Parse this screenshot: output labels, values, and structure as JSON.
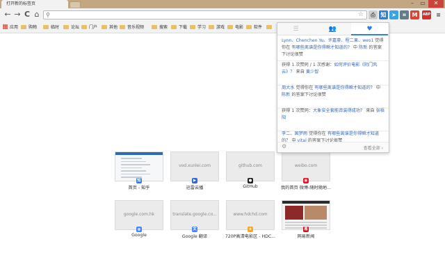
{
  "window": {
    "tab_title": "打开新的标签页",
    "controls": {
      "minimize": "–",
      "maximize": "▭",
      "close": "✕"
    }
  },
  "toolbar": {
    "back": "←",
    "forward": "→",
    "reload": "C",
    "home": "⌂",
    "omnibox_value": "",
    "omnibox_placeholder": "",
    "extensions": [
      {
        "icon": "printer-icon",
        "label": "⎙",
        "color": "#cfcfcf"
      },
      {
        "icon": "zhihu-icon",
        "label": "知",
        "color": "#2d82d6"
      },
      {
        "icon": "paper-plane-icon",
        "label": "➤",
        "color": "#3aa3e3"
      },
      {
        "icon": "crop-icon",
        "label": "⌗",
        "color": "#607d8b"
      },
      {
        "icon": "gmail-icon",
        "label": "M",
        "color": "#d44638"
      },
      {
        "icon": "adblock-icon",
        "label": "ABP",
        "color": "#d32f2f"
      },
      {
        "icon": "menu-icon",
        "label": "≡",
        "color": "#f2f2f2"
      }
    ]
  },
  "bookmarks": {
    "apps_label": "应用",
    "folders": [
      "购物",
      "临时",
      "论坛",
      "门户",
      "其他",
      "音乐视频",
      "搜索",
      "下载",
      "学习",
      "游戏",
      "电影",
      "软件",
      ""
    ]
  },
  "popup": {
    "tabs": [
      {
        "icon": "list-icon",
        "label": "☰"
      },
      {
        "icon": "people-icon",
        "label": "👥"
      },
      {
        "icon": "heart-icon",
        "label": "♥"
      }
    ],
    "items": [
      {
        "users": "Lynn、Chenchen Yu、许嘉豪、程二果、wes1",
        "text": " 觉得你在 ",
        "question": "有哪些离谱是你得瞬才知道的？",
        "tail": " 中 ",
        "author": "陈新",
        "end": " 的答案下讨论很赞"
      },
      {
        "users": "",
        "text": "获得 1 次赞同 / 1 次感谢：",
        "question": "如何评价电影《阴门风云》？",
        "tail": " 来自 ",
        "author": "黄少智",
        "end": ""
      },
      {
        "users": "周大水",
        "text": " 觉得你在 ",
        "question": "有哪些离谱是你得瞬才知道的？",
        "tail": " 中 ",
        "author": "陈新",
        "end": " 的答案下讨论很赞"
      },
      {
        "users": "",
        "text": "获得 1 次赞同：",
        "question": "大象安全套能否装得成功？",
        "tail": " 来自 ",
        "author": "张梧阳",
        "end": ""
      },
      {
        "users": "李二、国梦雨",
        "text": " 觉得你在 ",
        "question": "有哪些离谱是你得瞬才知道的？",
        "tail": " 中 ",
        "author": "vital",
        "end": " 的答案下讨论很赞"
      }
    ],
    "footer_more": "查看全部 ›"
  },
  "thumbnails": [
    {
      "url": "",
      "label": "首页 - 知乎",
      "icon": "zhihu-favicon-icon",
      "icon_text": "知",
      "icon_color": "#2d82d6"
    },
    {
      "url": "vod.xunlei.com",
      "label": "迅雷云播",
      "icon": "xunlei-favicon-icon",
      "icon_text": "▶",
      "icon_color": "#2a6fcf"
    },
    {
      "url": "github.com",
      "label": "GitHub",
      "icon": "github-favicon-icon",
      "icon_text": "●",
      "icon_color": "#222222"
    },
    {
      "url": "weibo.com",
      "label": "我的首页 微博-随时随地...",
      "icon": "weibo-favicon-icon",
      "icon_text": "◉",
      "icon_color": "#e6162d"
    },
    {
      "url": "google.com.hk",
      "label": "Google",
      "icon": "google-favicon-icon",
      "icon_text": "g",
      "icon_color": "#4285f4"
    },
    {
      "url": "translate.google.co...",
      "label": "Google 翻译",
      "icon": "translate-favicon-icon",
      "icon_text": "文",
      "icon_color": "#4285f4"
    },
    {
      "url": "www.hdchd.com",
      "label": "720P高清电影区 - HDC...",
      "icon": "hdc-favicon-icon",
      "icon_text": "★",
      "icon_color": "#f5a623"
    },
    {
      "url": "",
      "label": "网易新闻",
      "icon": "netease-favicon-icon",
      "icon_text": "易",
      "icon_color": "#c4161c"
    }
  ]
}
